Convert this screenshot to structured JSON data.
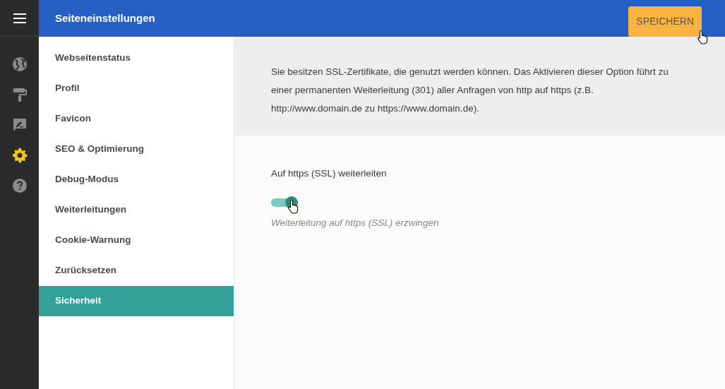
{
  "header": {
    "title": "Seiteneinstellungen",
    "save_button": "SPEICHERN"
  },
  "rail": [
    {
      "kind": "globe",
      "selected": false
    },
    {
      "kind": "roller",
      "selected": false
    },
    {
      "kind": "feedback",
      "selected": false
    },
    {
      "kind": "gear",
      "selected": true
    },
    {
      "kind": "help",
      "selected": false
    }
  ],
  "sidebar": {
    "items": [
      {
        "label": "Webseitenstatus",
        "selected": false
      },
      {
        "label": "Profil",
        "selected": false
      },
      {
        "label": "Favicon",
        "selected": false
      },
      {
        "label": "SEO & Optimierung",
        "selected": false
      },
      {
        "label": "Debug-Modus",
        "selected": false
      },
      {
        "label": "Weiterleitungen",
        "selected": false
      },
      {
        "label": "Cookie-Warnung",
        "selected": false
      },
      {
        "label": "Zurücksetzen",
        "selected": false
      },
      {
        "label": "Sicherheit",
        "selected": true
      }
    ]
  },
  "info": "Sie besitzen SSL-Zertifikate, die genutzt werden können. Das Aktivieren dieser Option führt zu einer permanenten Weiterleitung (301) aller Anfragen von http auf https (z.B. http://www.domain.de zu https://www.domain.de).",
  "setting": {
    "label": "Auf https (SSL) weiterleiten",
    "on": true,
    "hint": "Weiterleitung auf https (SSL) erzwingen"
  }
}
